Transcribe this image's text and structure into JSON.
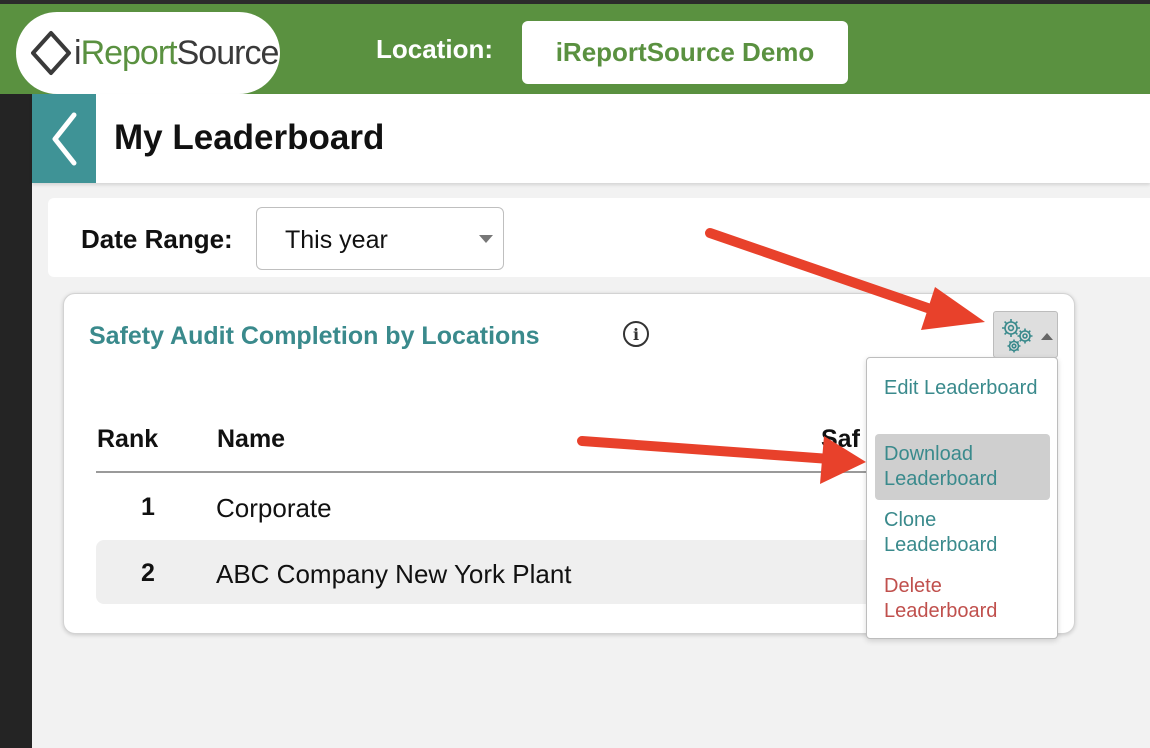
{
  "topbar": {
    "logo": {
      "prefix": "i",
      "report": "Report",
      "source": "Source"
    },
    "location_label": "Location:",
    "location_value": "iReportSource Demo"
  },
  "header": {
    "title": "My Leaderboard"
  },
  "filters": {
    "date_range_label": "Date Range:",
    "date_range_value": "This year"
  },
  "card": {
    "title": "Safety Audit Completion by Locations",
    "columns": {
      "rank": "Rank",
      "name": "Name",
      "partial": "Saf"
    },
    "rows": [
      {
        "rank": "1",
        "name": "Corporate"
      },
      {
        "rank": "2",
        "name": "ABC Company New York Plant"
      }
    ]
  },
  "menu": {
    "items": [
      {
        "label": "Edit Leaderboard"
      },
      {
        "label": "Download Leaderboard"
      },
      {
        "label": "Clone Leaderboard"
      },
      {
        "label": "Delete Leaderboard"
      }
    ]
  },
  "colors": {
    "brand_green": "#5a9140",
    "teal": "#3a8a8c",
    "danger": "#c0504d",
    "annotation_arrow": "#e8412b"
  }
}
